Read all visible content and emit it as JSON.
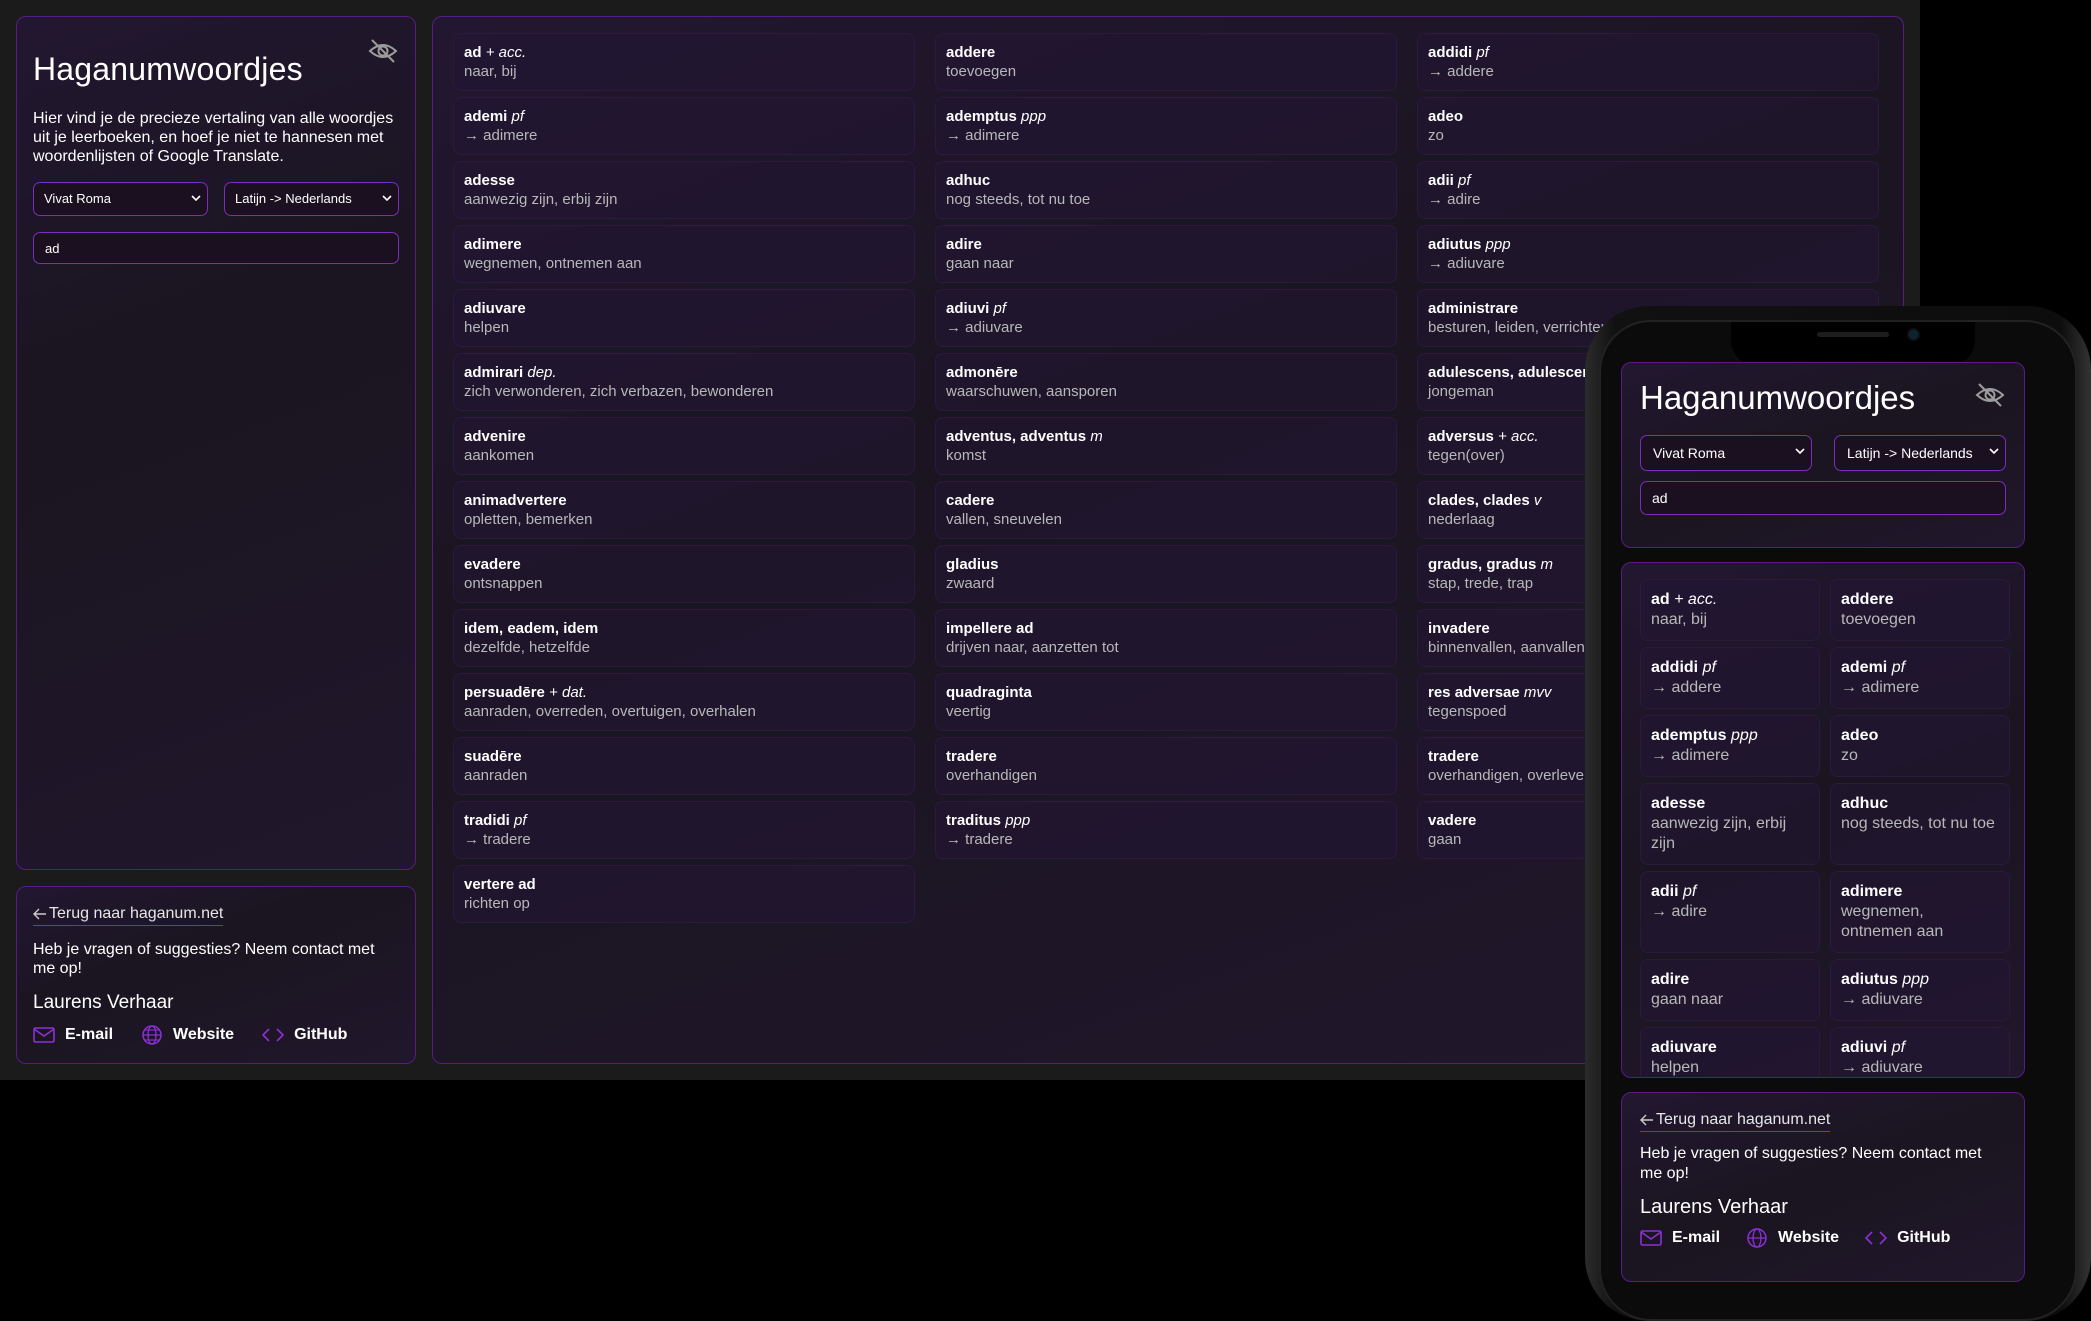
{
  "app": {
    "title": "Haganumwoordjes",
    "description": "Hier vind je de precieze vertaling van alle woordjes uit je leerboeken, en hoef je niet te hannesen met woordenlijsten of Google Translate.",
    "book_select": "Vivat Roma",
    "direction_select": "Latijn -> Nederlands",
    "search_value": "ad"
  },
  "footer": {
    "back_link": "Terug naar haganum.net",
    "contact_text": "Heb je vragen of suggesties? Neem contact met me op!",
    "author": "Laurens Verhaar",
    "email_label": "E-mail",
    "website_label": "Website",
    "github_label": "GitHub"
  },
  "accent_color": "#7d2bbf",
  "words": [
    {
      "w": "ad",
      "g": "+ acc.",
      "t": "naar, bij"
    },
    {
      "w": "addere",
      "g": "",
      "t": "toevoegen"
    },
    {
      "w": "addidi",
      "g": "pf",
      "t": "→ addere"
    },
    {
      "w": "ademi",
      "g": "pf",
      "t": "→ adimere"
    },
    {
      "w": "ademptus",
      "g": "ppp",
      "t": "→ adimere"
    },
    {
      "w": "adeo",
      "g": "",
      "t": "zo"
    },
    {
      "w": "adesse",
      "g": "",
      "t": "aanwezig zijn, erbij zijn"
    },
    {
      "w": "adhuc",
      "g": "",
      "t": "nog steeds, tot nu toe"
    },
    {
      "w": "adii",
      "g": "pf",
      "t": "→ adire"
    },
    {
      "w": "adimere",
      "g": "",
      "t": "wegnemen, ontnemen aan"
    },
    {
      "w": "adire",
      "g": "",
      "t": "gaan naar"
    },
    {
      "w": "adiutus",
      "g": "ppp",
      "t": "→ adiuvare"
    },
    {
      "w": "adiuvare",
      "g": "",
      "t": "helpen"
    },
    {
      "w": "adiuvi",
      "g": "pf",
      "t": "→ adiuvare"
    },
    {
      "w": "administrare",
      "g": "",
      "t": "besturen, leiden, verrichten"
    },
    {
      "w": "admirari",
      "g": "dep.",
      "t": "zich verwonderen, zich verbazen, bewonderen"
    },
    {
      "w": "admonēre",
      "g": "",
      "t": "waarschuwen, aansporen"
    },
    {
      "w": "adulescens, adulescent",
      "g": "",
      "t": "jongeman"
    },
    {
      "w": "advenire",
      "g": "",
      "t": "aankomen"
    },
    {
      "w": "adventus, adventus",
      "g": "m",
      "t": "komst"
    },
    {
      "w": "adversus",
      "g": "+ acc.",
      "t": "tegen(over)"
    },
    {
      "w": "animadvertere",
      "g": "",
      "t": "opletten, bemerken"
    },
    {
      "w": "cadere",
      "g": "",
      "t": "vallen, sneuvelen"
    },
    {
      "w": "clades, clades",
      "g": "v",
      "t": "nederlaag"
    },
    {
      "w": "evadere",
      "g": "",
      "t": "ontsnappen"
    },
    {
      "w": "gladius",
      "g": "",
      "t": "zwaard"
    },
    {
      "w": "gradus, gradus",
      "g": "m",
      "t": "stap, trede, trap"
    },
    {
      "w": "idem, eadem, idem",
      "g": "",
      "t": "dezelfde, hetzelfde"
    },
    {
      "w": "impellere ad",
      "g": "",
      "t": "drijven naar, aanzetten tot"
    },
    {
      "w": "invadere",
      "g": "",
      "t": "binnenvallen, aanvallen"
    },
    {
      "w": "persuadēre",
      "g": "+ dat.",
      "t": "aanraden, overreden, overtuigen, overhalen"
    },
    {
      "w": "quadraginta",
      "g": "",
      "t": "veertig"
    },
    {
      "w": "res adversae",
      "g": "mvv",
      "t": "tegenspoed"
    },
    {
      "w": "suadēre",
      "g": "",
      "t": "aanraden"
    },
    {
      "w": "tradere",
      "g": "",
      "t": "overhandigen"
    },
    {
      "w": "tradere",
      "g": "",
      "t": "overhandigen, overleveren"
    },
    {
      "w": "tradidi",
      "g": "pf",
      "t": "→ tradere"
    },
    {
      "w": "traditus",
      "g": "ppp",
      "t": "→ tradere"
    },
    {
      "w": "vadere",
      "g": "",
      "t": "gaan"
    },
    {
      "w": "vertere ad",
      "g": "",
      "t": "richten op"
    }
  ],
  "mobile_words": [
    {
      "w": "ad",
      "g": "+ acc.",
      "t": "naar, bij"
    },
    {
      "w": "addere",
      "g": "",
      "t": "toevoegen"
    },
    {
      "w": "addidi",
      "g": "pf",
      "t": "→ addere"
    },
    {
      "w": "ademi",
      "g": "pf",
      "t": "→ adimere"
    },
    {
      "w": "ademptus",
      "g": "ppp",
      "t": "→ adimere"
    },
    {
      "w": "adeo",
      "g": "",
      "t": "zo"
    },
    {
      "w": "adesse",
      "g": "",
      "t": "aanwezig zijn, erbij zijn"
    },
    {
      "w": "adhuc",
      "g": "",
      "t": "nog steeds, tot nu toe"
    },
    {
      "w": "adii",
      "g": "pf",
      "t": "→ adire"
    },
    {
      "w": "adimere",
      "g": "",
      "t": "wegnemen, ontnemen aan"
    },
    {
      "w": "adire",
      "g": "",
      "t": "gaan naar"
    },
    {
      "w": "adiutus",
      "g": "ppp",
      "t": "→ adiuvare"
    },
    {
      "w": "adiuvare",
      "g": "",
      "t": "helpen"
    },
    {
      "w": "adiuvi",
      "g": "pf",
      "t": "→ adiuvare"
    }
  ]
}
